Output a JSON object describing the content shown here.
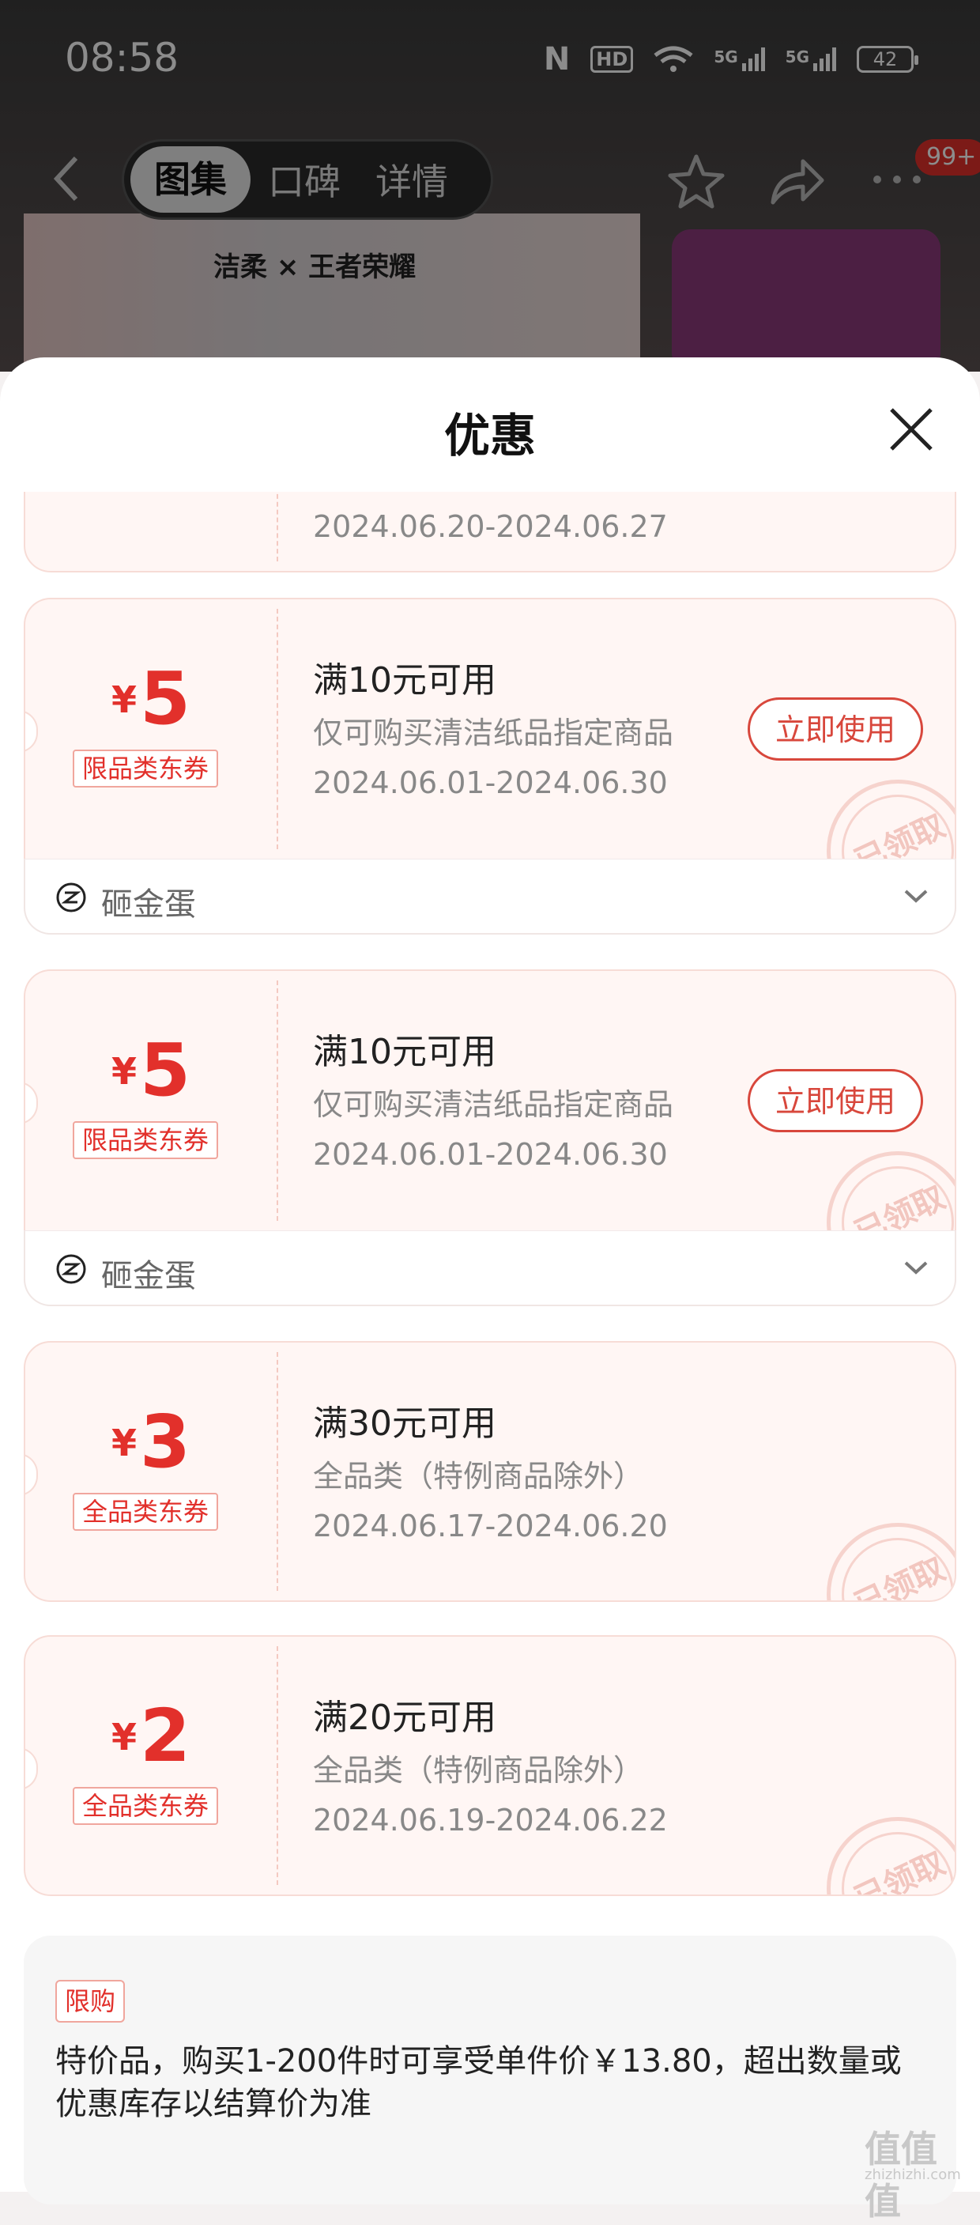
{
  "status_bar": {
    "time": "08:58",
    "nfc": "N",
    "hd": "HD",
    "net1": "5G",
    "net2": "5G",
    "battery": "42"
  },
  "nav": {
    "tabs": [
      {
        "label": "图集",
        "active": true
      },
      {
        "label": "口碑",
        "active": false
      },
      {
        "label": "详情",
        "active": false
      }
    ],
    "badge": "99+",
    "icons": [
      "back-icon",
      "star-icon",
      "share-icon",
      "more-icon"
    ]
  },
  "banner": {
    "text": "洁柔 × 王者荣耀"
  },
  "sheet": {
    "title": "优惠"
  },
  "partial_coupon": {
    "dates": "2024.06.20-2024.06.27"
  },
  "coupons": [
    {
      "symbol": "¥",
      "amount": "5",
      "type": "限品类东券",
      "condition": "满10元可用",
      "scope": "仅可购买清洁纸品指定商品",
      "dates": "2024.06.01-2024.06.30",
      "button": "立即使用",
      "stamp": "已领取",
      "footer": "砸金蛋"
    },
    {
      "symbol": "¥",
      "amount": "5",
      "type": "限品类东券",
      "condition": "满10元可用",
      "scope": "仅可购买清洁纸品指定商品",
      "dates": "2024.06.01-2024.06.30",
      "button": "立即使用",
      "stamp": "已领取",
      "footer": "砸金蛋"
    },
    {
      "symbol": "¥",
      "amount": "3",
      "type": "全品类东券",
      "condition": "满30元可用",
      "scope": "全品类（特例商品除外）",
      "dates": "2024.06.17-2024.06.20",
      "stamp": "已领取"
    },
    {
      "symbol": "¥",
      "amount": "2",
      "type": "全品类东券",
      "condition": "满20元可用",
      "scope": "全品类（特例商品除外）",
      "dates": "2024.06.19-2024.06.22",
      "stamp": "已领取"
    }
  ],
  "limit": {
    "tag": "限购",
    "text": "特价品，购买1-200件时可享受单件价￥13.80，超出数量或优惠库存以结算价为准"
  },
  "watermark": {
    "glyphs": "值值值",
    "url": "zhizhizhi.com"
  },
  "colors": {
    "accent": "#e2302b",
    "coupon_bg": "#fff6f4",
    "button": "#d8473c"
  }
}
